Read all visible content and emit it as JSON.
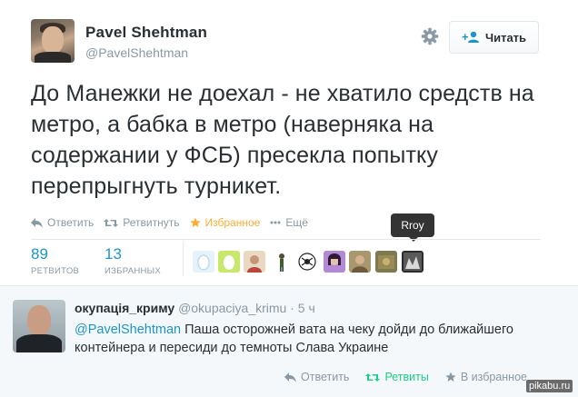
{
  "tweet": {
    "author_name": "Pavel Shehtman",
    "author_handle": "@PavelShehtman",
    "follow_label": "Читать",
    "text": "До Манежки не доехал - не хватило средств на метро, а бабка в метро (наверняка на содержании у ФСБ) пресекла попытку перепрыгнуть турникет.",
    "actions": {
      "reply": "Ответить",
      "retweet": "Ретвитнуть",
      "favorite": "Избранное",
      "more": "Ещё"
    },
    "tooltip": "Rroy",
    "stats": {
      "retweets_count": "89",
      "retweets_label": "РЕТВИТОВ",
      "favorites_count": "13",
      "favorites_label": "ИЗБРАННЫХ"
    }
  },
  "reply": {
    "author_name": "окупація_криму",
    "author_handle": "@okupaciya_krimu",
    "time": "· 5 ч",
    "mention": "@PavelShehtman",
    "text": " Паша осторожней вата на чеку дойди до ближайшего контейнера и пересиди до темноты Слава Украине",
    "actions": {
      "reply": "Ответить",
      "retweet": "Ретвиты",
      "favorite": "В избранное"
    }
  },
  "watermark": "pikabu.ru",
  "colors": {
    "link": "#1b95c9",
    "favorite": "#ffac33",
    "retweet_active": "#19cf86",
    "muted": "#8899a6",
    "text": "#292f33"
  },
  "icons": [
    "gear-icon",
    "follow-user-icon",
    "reply-icon",
    "retweet-icon",
    "star-icon",
    "more-icon"
  ]
}
